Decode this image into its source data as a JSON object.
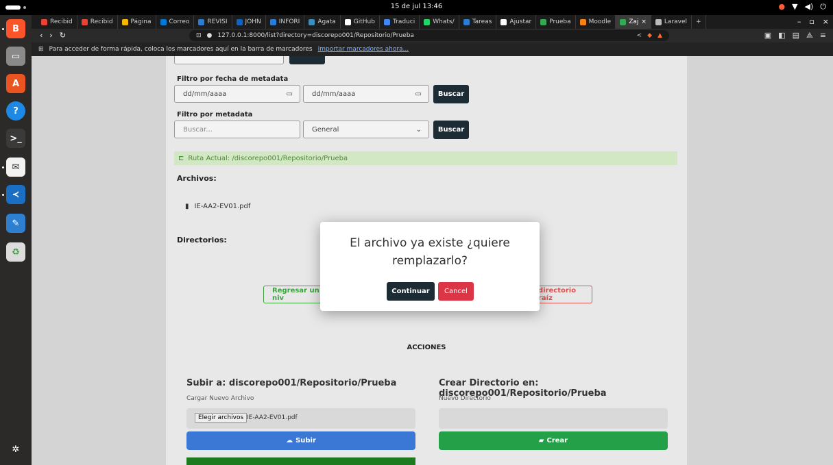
{
  "system": {
    "clock": "15 de jul 13:46"
  },
  "tabs": [
    {
      "label": "Recibid",
      "color": "#ea4335"
    },
    {
      "label": "Recibid",
      "color": "#ea4335"
    },
    {
      "label": "Página",
      "color": "#f4b400"
    },
    {
      "label": "Correo",
      "color": "#0078d4"
    },
    {
      "label": "REVISI",
      "color": "#2b7cd3"
    },
    {
      "label": "JOHN",
      "color": "#0a66c2"
    },
    {
      "label": "INFORI",
      "color": "#2b7cd3"
    },
    {
      "label": "Agata",
      "color": "#3c8dbc"
    },
    {
      "label": "GitHub",
      "color": "#ffffff"
    },
    {
      "label": "Traduci",
      "color": "#4285f4"
    },
    {
      "label": "Whats/",
      "color": "#25d366"
    },
    {
      "label": "Tareas",
      "color": "#2b7cd3"
    },
    {
      "label": "Ajustar",
      "color": "#ffffff"
    },
    {
      "label": "Prueba",
      "color": "#34a853"
    },
    {
      "label": "Moodle",
      "color": "#f98012"
    },
    {
      "label": "Zaj",
      "color": "#34a853",
      "active": true
    },
    {
      "label": "Laravel",
      "color": "#bbbbbb"
    }
  ],
  "url": "127.0.0.1:8000/list?directory=discorepo001/Repositorio/Prueba",
  "bookmarks": {
    "text": "Para acceder de forma rápida, coloca los marcadores aquí en la barra de marcadores",
    "link": "Importar marcadores ahora..."
  },
  "filters": {
    "date_label": "Filtro por fecha de metadata",
    "date_from_placeholder": "dd/mm/aaaa",
    "date_to_placeholder": "dd/mm/aaaa",
    "search_button": "Buscar",
    "meta_label": "Filtro por metadata",
    "meta_placeholder": "Buscar...",
    "meta_select": "General"
  },
  "route": {
    "text": "Ruta Actual:  /discorepo001/Repositorio/Prueba"
  },
  "files": {
    "heading": "Archivos:",
    "items": [
      "IE-AA2-EV01.pdf"
    ]
  },
  "dirs": {
    "heading": "Directorios:"
  },
  "nav_buttons": {
    "back": "Regresar un niv",
    "root": "directorio raíz"
  },
  "actions": {
    "heading": "ACCIONES",
    "upload_title": "Subir a: discorepo001/Repositorio/Prueba",
    "upload_label": "Cargar Nuevo Archivo",
    "choose_button": "Elegir archivos",
    "chosen_file": "IE-AA2-EV01.pdf",
    "upload_button": "Subir",
    "create_title": "Crear Directorio en: discorepo001/Repositorio/Prueba",
    "create_label": "Nuevo Directorio",
    "create_button": "Crear"
  },
  "dialog": {
    "message": "El archivo ya existe ¿quiere remplazarlo?",
    "confirm": "Continuar",
    "cancel": "Cancel"
  }
}
